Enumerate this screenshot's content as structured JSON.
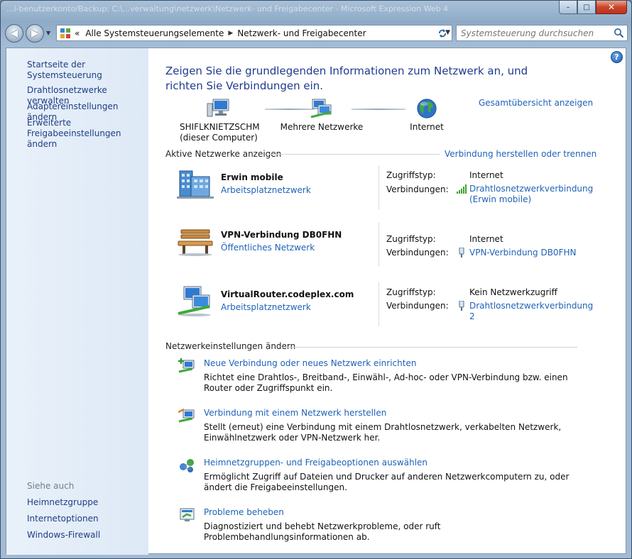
{
  "window": {
    "title": "...l-benutzerkonto/Backup: C:\\...verwaltung\\netzwerk\\Netzwerk- und Freigabecenter - Microsoft Expression Web 4",
    "minimize_glyph": "–",
    "maximize_glyph": "□",
    "close_glyph": "✕"
  },
  "nav": {
    "back_glyph": "◀",
    "forward_glyph": "▶",
    "address_prefix": "«",
    "breadcrumb": [
      "Alle Systemsteuerungselemente",
      "Netzwerk- und Freigabecenter"
    ],
    "search_placeholder": "Systemsteuerung durchsuchen"
  },
  "sidebar": {
    "home": "Startseite der Systemsteuerung",
    "links": [
      "Drahtlosnetzwerke verwalten",
      "Adaptereinstellungen ändern",
      "Erweiterte Freigabeeinstellungen ändern"
    ],
    "see_also_title": "Siehe auch",
    "see_also": [
      "Heimnetzgruppe",
      "Internetoptionen",
      "Windows-Firewall"
    ]
  },
  "help_glyph": "?",
  "main": {
    "heading": "Zeigen Sie die grundlegenden Informationen zum Netzwerk an, und richten Sie Verbindungen ein.",
    "full_map_link": "Gesamtübersicht anzeigen",
    "map": {
      "computer_name": "SHIFLKNIETZSCHM",
      "computer_sub": "(dieser Computer)",
      "networks": "Mehrere Netzwerke",
      "internet": "Internet"
    },
    "active_title": "Aktive Netzwerke anzeigen",
    "connect_link": "Verbindung herstellen oder trennen",
    "access_label": "Zugriffstyp:",
    "connections_label": "Verbindungen:",
    "networks": [
      {
        "name": "Erwin mobile",
        "type": "Arbeitsplatznetzwerk",
        "access": "Internet",
        "connection": "Drahtlosnetzwerkverbindung (Erwin mobile)"
      },
      {
        "name": "VPN-Verbindung DB0FHN",
        "type": "Öffentliches Netzwerk",
        "access": "Internet",
        "connection": "VPN-Verbindung DB0FHN"
      },
      {
        "name": "VirtualRouter.codeplex.com",
        "type": "Arbeitsplatznetzwerk",
        "access": "Kein Netzwerkzugriff",
        "connection": "Drahtlosnetzwerkverbindung 2"
      }
    ],
    "settings_title": "Netzwerkeinstellungen ändern",
    "tasks": [
      {
        "title": "Neue Verbindung oder neues Netzwerk einrichten",
        "desc": "Richtet eine Drahtlos-, Breitband-, Einwähl-, Ad-hoc- oder VPN-Verbindung bzw. einen Router oder Zugriffspunkt ein."
      },
      {
        "title": "Verbindung mit einem Netzwerk herstellen",
        "desc": "Stellt (erneut) eine Verbindung mit einem Drahtlosnetzwerk, verkabelten Netzwerk, Einwählnetzwerk oder VPN-Netzwerk her."
      },
      {
        "title": "Heimnetzgruppen- und Freigabeoptionen auswählen",
        "desc": "Ermöglicht Zugriff auf Dateien und Drucker auf anderen Netzwerkcomputern zu, oder ändert die Freigabeeinstellungen."
      },
      {
        "title": "Probleme beheben",
        "desc": "Diagnostiziert und behebt Netzwerkprobleme, oder ruft Problembehandlungsinformationen ab."
      }
    ]
  }
}
